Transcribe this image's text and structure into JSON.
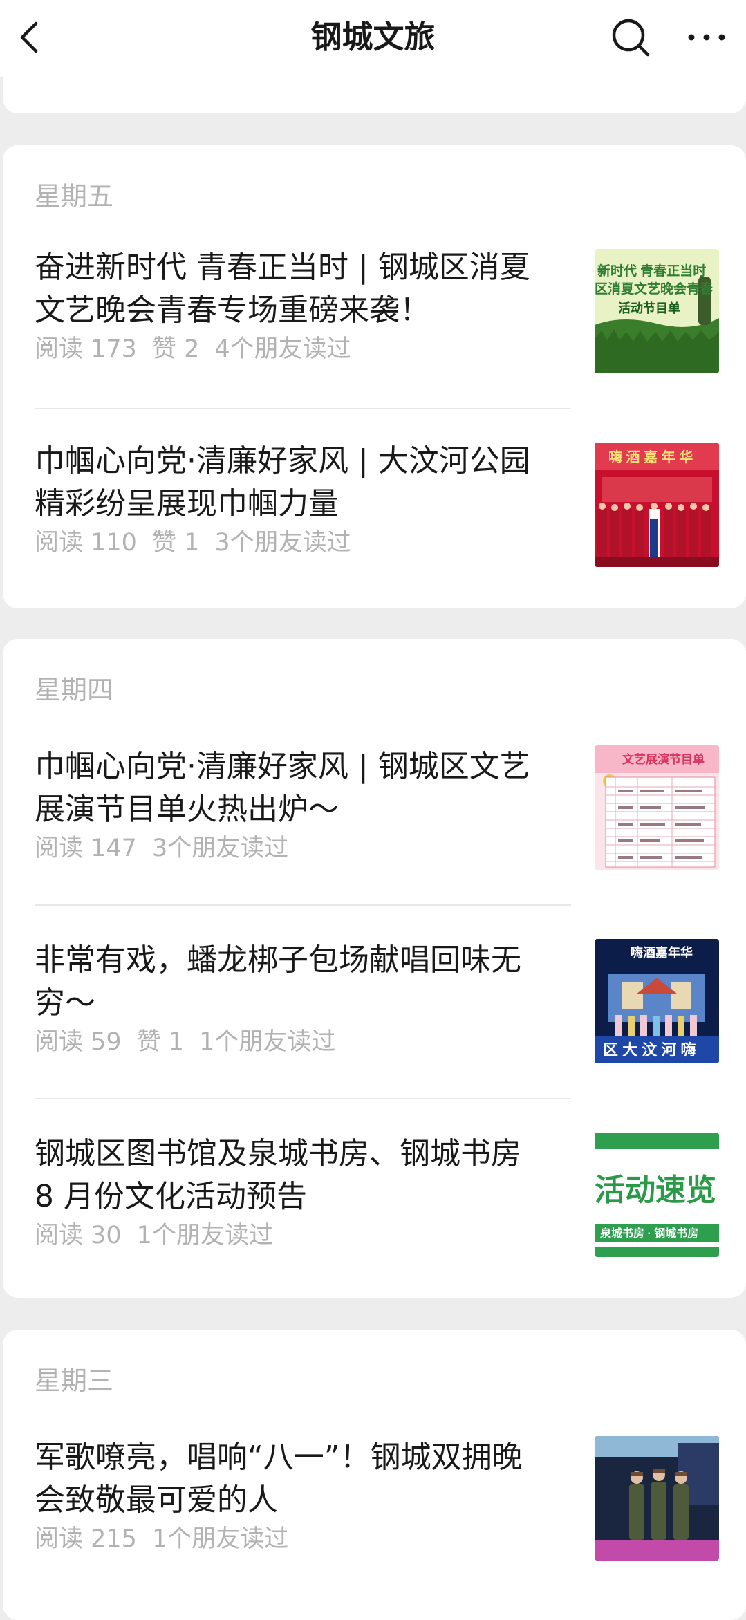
{
  "header": {
    "title": "钢城文旅",
    "back_icon": "chevron-left-icon",
    "search_icon": "search-icon",
    "more_icon": "more-dots-icon"
  },
  "groups": [
    {
      "day": "星期五",
      "articles": [
        {
          "title": "奋进新时代 青春正当时 | 钢城区消夏\n文艺晚会青春专场重磅来袭！",
          "reads": "阅读 173",
          "likes": "赞 2",
          "friends": "4个朋友读过",
          "thumb_text": [
            "新时代 青春正当时",
            "区消夏文艺晚会青春",
            "活动节目单"
          ]
        },
        {
          "title": "巾帼心向党·清廉好家风 | 大汶河公园\n精彩纷呈展现巾帼力量",
          "reads": "阅读 110",
          "likes": "赞 1",
          "friends": "3个朋友读过",
          "thumb_text": [
            "嗨 酒 嘉 年 华"
          ]
        }
      ]
    },
    {
      "day": "星期四",
      "articles": [
        {
          "title": "巾帼心向党·清廉好家风 | 钢城区文艺\n展演节目单火热出炉～",
          "reads": "阅读 147",
          "likes": "",
          "friends": "3个朋友读过",
          "thumb_text": [
            "文艺展演节目单"
          ]
        },
        {
          "title": "非常有戏，蟠龙梆子包场献唱回味无\n穷～",
          "reads": "阅读 59",
          "likes": "赞 1",
          "friends": "1个朋友读过",
          "thumb_text": [
            "嗨酒嘉年华",
            "区 大 汶 河 嗨"
          ]
        },
        {
          "title": "钢城区图书馆及泉城书房、钢城书房\n8 月份文化活动预告",
          "reads": "阅读 30",
          "likes": "",
          "friends": "1个朋友读过",
          "thumb_text": [
            "活动速览",
            "泉城书房 · 钢城书房"
          ]
        }
      ]
    },
    {
      "day": "星期三",
      "articles": [
        {
          "title": "军歌嘹亮，唱响“八一”！钢城双拥晚\n会致敬最可爱的人",
          "reads": "阅读 215",
          "likes": "",
          "friends": "1个朋友读过",
          "thumb_text": []
        }
      ]
    }
  ],
  "colors": {
    "background": "#ededed",
    "card": "#ffffff",
    "secondary_text": "#b2b2b2",
    "primary_text": "#191919"
  }
}
